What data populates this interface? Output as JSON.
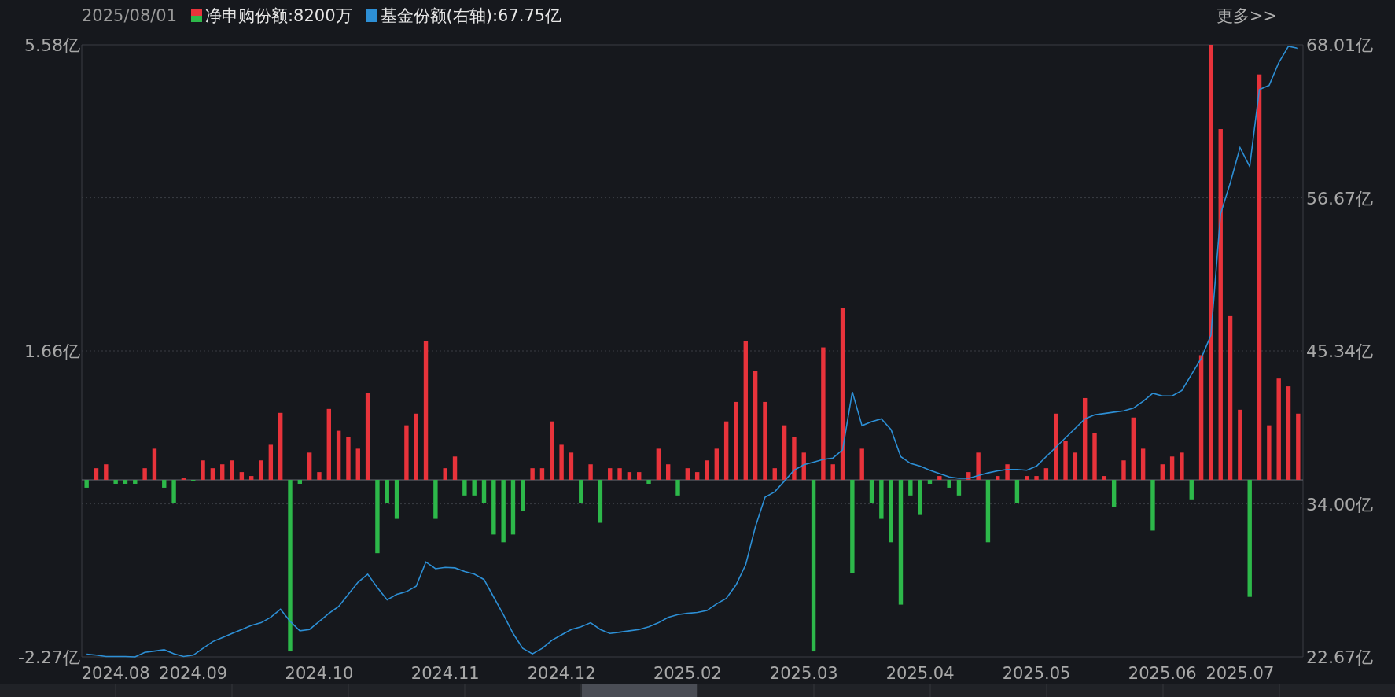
{
  "header": {
    "date": "2025/08/01",
    "legend": [
      {
        "value": ":8200万"
      },
      {
        "value": ":67.75亿"
      }
    ],
    "more_link": "更多>>"
  },
  "chart_data": {
    "type": "bar",
    "ylim": [
      -2.27,
      5.58
    ],
    "yticks": [
      {
        "value": 5.58,
        "label": "5.58亿"
      },
      {
        "value": 1.66,
        "label": "1.66亿"
      },
      {
        "value": -2.27,
        "label": "-2.27亿"
      }
    ],
    "y2lim": [
      22.67,
      68.01
    ],
    "y2ticks": [
      {
        "value": 68.01,
        "label": "68.01亿"
      },
      {
        "value": 56.67,
        "label": "56.67亿"
      },
      {
        "value": 45.34,
        "label": "45.34亿"
      },
      {
        "value": 34.0,
        "label": "34.00亿"
      },
      {
        "value": 22.67,
        "label": "22.67亿"
      }
    ],
    "grid": true,
    "categories": [
      null,
      null,
      null,
      "2024.08",
      null,
      null,
      null,
      null,
      null,
      null,
      null,
      "2024.09",
      null,
      null,
      null,
      null,
      null,
      null,
      null,
      null,
      null,
      null,
      null,
      null,
      "2024.10",
      null,
      null,
      null,
      null,
      null,
      null,
      null,
      null,
      null,
      null,
      null,
      null,
      "2024.11",
      null,
      null,
      null,
      null,
      null,
      null,
      null,
      null,
      null,
      null,
      null,
      "2024.12",
      null,
      null,
      null,
      null,
      null,
      null,
      null,
      null,
      null,
      null,
      null,
      null,
      "2025.02",
      null,
      null,
      null,
      null,
      null,
      null,
      null,
      null,
      null,
      null,
      null,
      "2025.03",
      null,
      null,
      null,
      null,
      null,
      null,
      null,
      null,
      null,
      null,
      null,
      "2025.04",
      null,
      null,
      null,
      null,
      null,
      null,
      null,
      null,
      null,
      null,
      null,
      "2025.05",
      null,
      null,
      null,
      null,
      null,
      null,
      null,
      null,
      null,
      null,
      null,
      null,
      "2025.06",
      null,
      null,
      null,
      null,
      null,
      null,
      null,
      "2025.07",
      null,
      null,
      null,
      null,
      null,
      null
    ],
    "series": [
      {
        "name": "净申购份额",
        "color": "#e8333b",
        "values": [
          null,
          0.15,
          0.2,
          null,
          null,
          null,
          0.15,
          0.4,
          null,
          null,
          0.02,
          null,
          0.25,
          0.15,
          0.2,
          0.25,
          0.1,
          0.05,
          0.25,
          0.45,
          0.86,
          null,
          null,
          0.35,
          0.1,
          0.91,
          0.63,
          0.55,
          0.4,
          1.12,
          null,
          null,
          null,
          0.7,
          0.85,
          1.78,
          null,
          0.15,
          0.3,
          null,
          null,
          null,
          null,
          null,
          null,
          null,
          0.15,
          0.15,
          0.75,
          0.45,
          0.35,
          null,
          0.2,
          null,
          0.15,
          0.15,
          0.1,
          0.1,
          null,
          0.4,
          0.2,
          null,
          0.15,
          0.1,
          0.25,
          0.4,
          0.75,
          1.0,
          1.78,
          1.4,
          1.0,
          0.15,
          0.7,
          0.55,
          0.35,
          null,
          1.7,
          0.2,
          2.2,
          null,
          0.4,
          null,
          null,
          null,
          null,
          null,
          null,
          null,
          0.05,
          null,
          null,
          0.1,
          0.35,
          null,
          0.05,
          0.2,
          null,
          0.05,
          0.05,
          0.15,
          0.85,
          0.5,
          0.35,
          1.05,
          0.6,
          0.05,
          null,
          0.25,
          0.8,
          0.4,
          null,
          0.2,
          0.3,
          0.35,
          null,
          1.6,
          5.58,
          4.5,
          2.1,
          0.9,
          null,
          5.2,
          0.7,
          1.3,
          1.2,
          0.85
        ]
      },
      {
        "color": "#2db84a",
        "values": [
          -0.1,
          null,
          null,
          -0.05,
          -0.05,
          -0.05,
          null,
          null,
          -0.1,
          -0.3,
          null,
          -0.02,
          null,
          null,
          null,
          null,
          null,
          null,
          null,
          null,
          null,
          -2.2,
          -0.05,
          null,
          null,
          null,
          null,
          null,
          null,
          null,
          -0.94,
          -0.3,
          -0.5,
          null,
          null,
          null,
          -0.5,
          null,
          null,
          -0.2,
          -0.2,
          -0.3,
          -0.7,
          -0.8,
          -0.7,
          -0.4,
          null,
          null,
          null,
          null,
          null,
          -0.3,
          null,
          -0.55,
          null,
          null,
          null,
          null,
          -0.05,
          null,
          null,
          -0.2,
          null,
          null,
          null,
          null,
          null,
          null,
          null,
          null,
          null,
          null,
          null,
          null,
          null,
          -2.2,
          null,
          null,
          null,
          -1.2,
          null,
          -0.3,
          -0.5,
          -0.8,
          -1.6,
          -0.2,
          -0.45,
          -0.05,
          null,
          -0.1,
          -0.2,
          null,
          null,
          -0.8,
          null,
          null,
          -0.3,
          null,
          null,
          null,
          null,
          null,
          null,
          null,
          null,
          null,
          -0.35,
          null,
          null,
          null,
          -0.65,
          null,
          null,
          null,
          -0.25,
          null,
          null,
          null,
          null,
          null,
          -1.5,
          null,
          null,
          null,
          null,
          null
        ]
      },
      {
        "name": "基金份额(右轴)",
        "type": "line",
        "axis": "y2",
        "color": "#2d8fd5",
        "values": [
          22.87,
          22.8,
          22.7,
          22.7,
          22.7,
          22.67,
          23.0,
          23.1,
          23.2,
          22.9,
          22.7,
          22.8,
          23.3,
          23.8,
          24.1,
          24.4,
          24.7,
          25.0,
          25.2,
          25.6,
          26.2,
          25.3,
          24.6,
          24.7,
          25.3,
          25.9,
          26.4,
          27.3,
          28.2,
          28.8,
          27.8,
          26.9,
          27.3,
          27.5,
          27.9,
          29.7,
          29.2,
          29.3,
          29.26,
          29.0,
          28.8,
          28.4,
          27.1,
          25.8,
          24.4,
          23.3,
          22.9,
          23.3,
          23.9,
          24.3,
          24.7,
          24.9,
          25.2,
          24.7,
          24.4,
          24.5,
          24.6,
          24.7,
          24.9,
          25.2,
          25.6,
          25.8,
          25.9,
          25.96,
          26.1,
          26.6,
          27.0,
          28.0,
          29.5,
          32.3,
          34.5,
          34.9,
          35.7,
          36.5,
          36.9,
          37.1,
          37.3,
          37.4,
          38.0,
          42.3,
          39.8,
          40.1,
          40.3,
          39.5,
          37.5,
          37.0,
          36.8,
          36.5,
          36.25,
          36.0,
          35.9,
          35.9,
          36.1,
          36.3,
          36.45,
          36.55,
          36.55,
          36.5,
          36.8,
          37.5,
          38.2,
          38.9,
          39.6,
          40.3,
          40.6,
          40.7,
          40.8,
          40.9,
          41.1,
          41.6,
          42.2,
          42.0,
          42.0,
          42.4,
          43.6,
          44.8,
          46.5,
          55.5,
          57.8,
          60.4,
          59.0,
          64.7,
          65.0,
          66.7,
          67.9,
          67.75
        ]
      }
    ]
  }
}
